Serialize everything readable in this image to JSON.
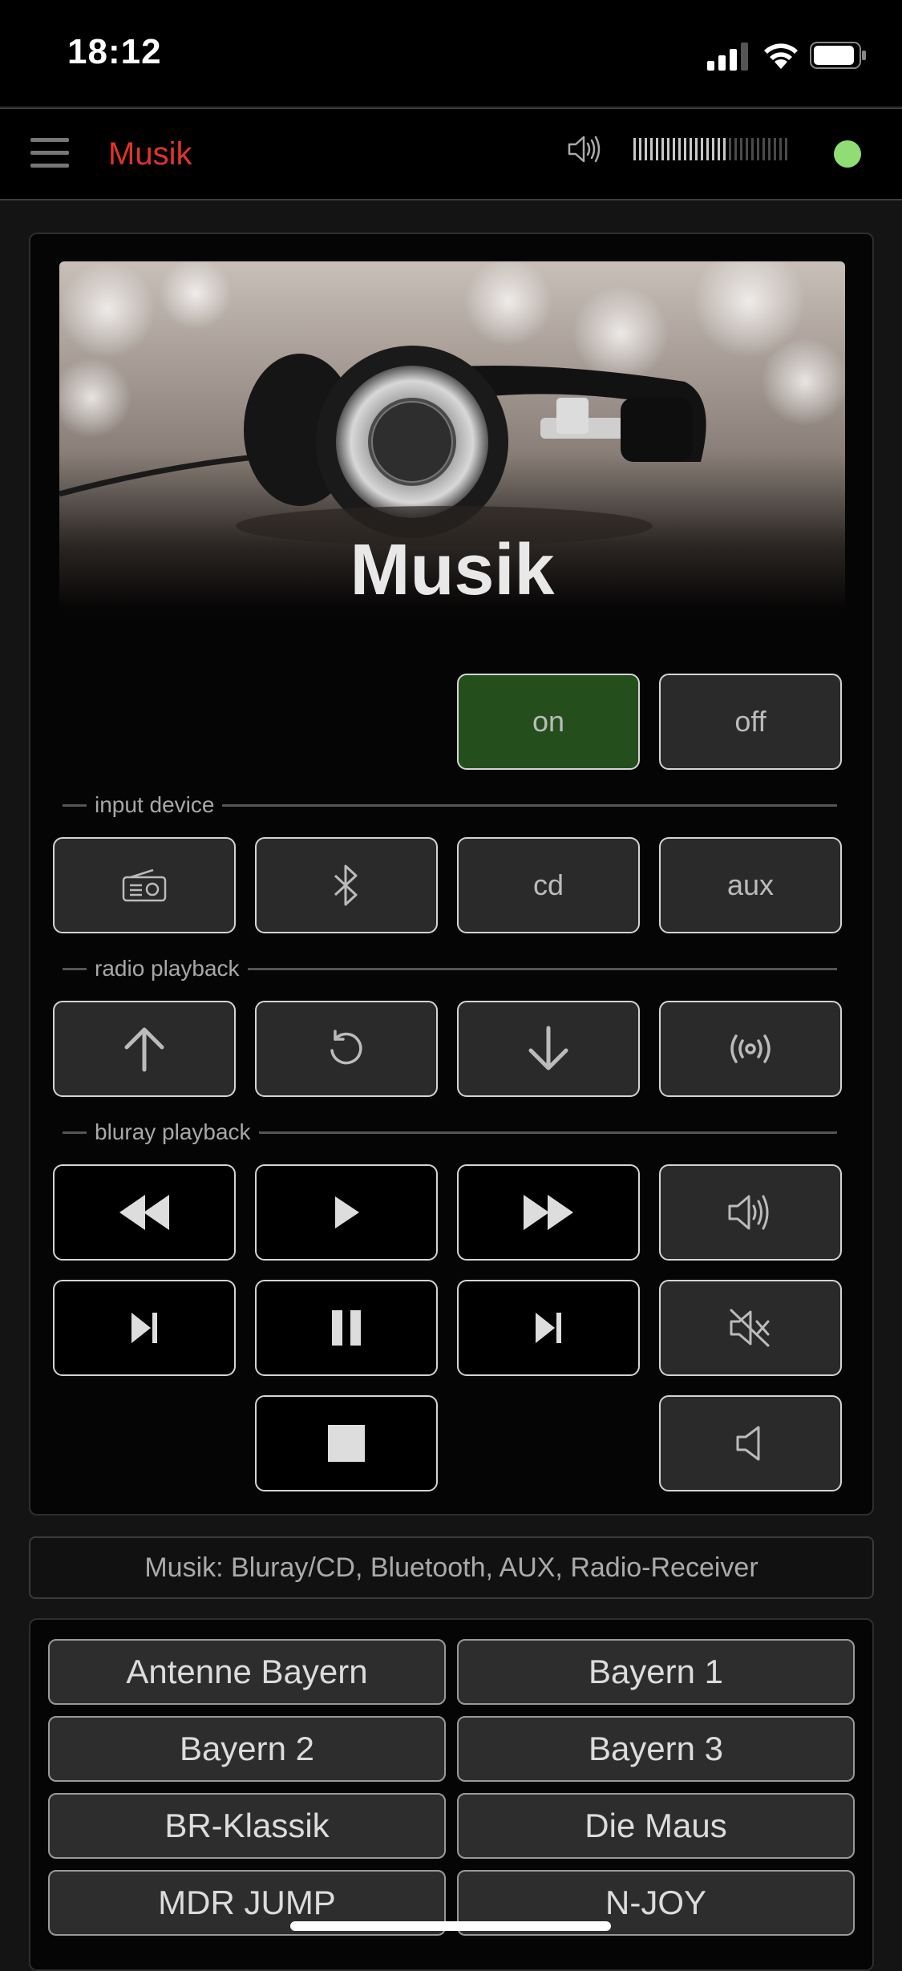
{
  "status_bar": {
    "time": "18:12",
    "icons": [
      "signal-icon",
      "wifi-icon",
      "battery-icon"
    ]
  },
  "appbar": {
    "menu_icon": "hamburger-menu-icon",
    "title": "Musik",
    "title_color": "#e0342b",
    "volume_icon": "speaker-icon",
    "volume_level": 0.62,
    "status_color": "#8fdd74"
  },
  "hero": {
    "image": "headphones-photo",
    "title": "Musik"
  },
  "power": {
    "on_label": "on",
    "off_label": "off",
    "active": "on",
    "active_color": "#244f1c"
  },
  "input_device": {
    "label": "input device",
    "buttons": [
      {
        "icon": "radio-icon",
        "label": ""
      },
      {
        "icon": "bluetooth-icon",
        "label": ""
      },
      {
        "icon": "",
        "label": "cd"
      },
      {
        "icon": "",
        "label": "aux"
      }
    ]
  },
  "radio_playback": {
    "label": "radio playback",
    "buttons": [
      {
        "icon": "arrow-up-icon"
      },
      {
        "icon": "refresh-icon"
      },
      {
        "icon": "arrow-down-icon"
      },
      {
        "icon": "broadcast-icon"
      }
    ]
  },
  "bluray_playback": {
    "label": "bluray playback",
    "buttons": [
      {
        "icon": "rewind-icon"
      },
      {
        "icon": "play-icon"
      },
      {
        "icon": "fast-forward-icon"
      },
      {
        "icon": "volume-up-icon"
      },
      {
        "icon": "skip-next-icon"
      },
      {
        "icon": "pause-icon"
      },
      {
        "icon": "skip-next-icon"
      },
      {
        "icon": "mute-icon"
      },
      {
        "icon": "stop-icon"
      },
      {
        "icon": "volume-down-icon"
      }
    ]
  },
  "info": {
    "text": "Musik: Bluray/CD, Bluetooth, AUX, Radio-Receiver"
  },
  "stations": [
    {
      "label": "Antenne Bayern"
    },
    {
      "label": "Bayern 1"
    },
    {
      "label": "Bayern 2"
    },
    {
      "label": "Bayern 3"
    },
    {
      "label": "BR-Klassik"
    },
    {
      "label": "Die Maus"
    },
    {
      "label": "MDR JUMP"
    },
    {
      "label": "N-JOY"
    }
  ]
}
